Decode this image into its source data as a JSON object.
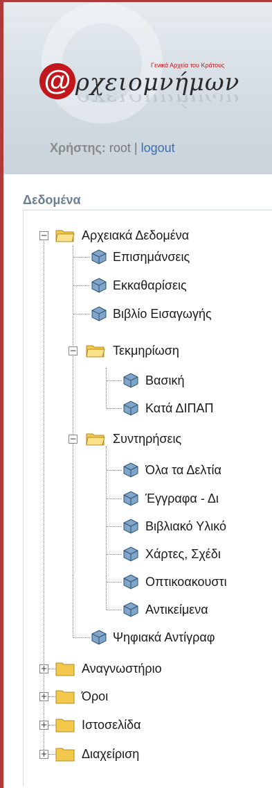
{
  "header": {
    "logo_small": "Γενικά Αρχεία του Κράτους",
    "logo_title": "ρχειομνήμων",
    "user_label": "Χρήστης:",
    "user_name": "root",
    "separator": "|",
    "logout": "logout"
  },
  "sidebar": {
    "section_title": "Δεδομένα",
    "tree": {
      "archival": "Αρχειακά Δεδομένα",
      "episimanseis": "Επισημάνσεις",
      "ekkatharises": "Εκκαθαρίσεις",
      "vivlio": "Βιβλίο Εισαγωγής",
      "tekmiriosi": "Τεκμηρίωση",
      "vasiki": "Βασική",
      "kata_dipap": "Κατά ΔΙΠΑΠ",
      "syntiriseis": "Συντηρήσεις",
      "ola_deltia": "Όλα τα Δελτία",
      "eggrafa": "Έγγραφα - Δι",
      "vivliako": "Βιβλιακό Υλικό",
      "chartes": "Χάρτες, Σχέδι",
      "optikoakoustiko": "Οπτικοακουστι",
      "antikeimena": "Αντικείμενα",
      "psifiaka": "Ψηφιακά Αντίγραφ",
      "anagnostirio": "Αναγνωστήριο",
      "oroi": "Όροι",
      "istoselida": "Ιστοσελίδα",
      "diacheirisi": "Διαχείριση"
    }
  }
}
